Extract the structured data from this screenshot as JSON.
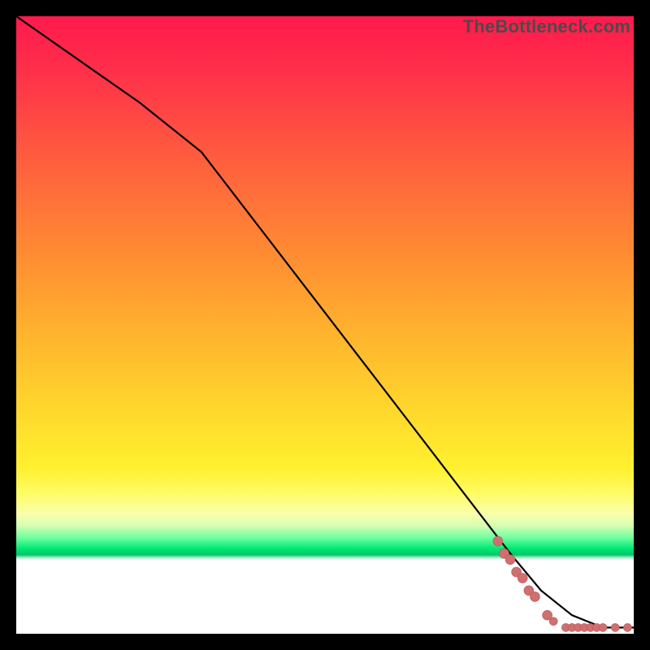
{
  "watermark": "TheBottleneck.com",
  "chart_data": {
    "type": "line",
    "title": "",
    "xlabel": "",
    "ylabel": "",
    "xlim": [
      0,
      100
    ],
    "ylim": [
      0,
      100
    ],
    "grid": false,
    "legend": false,
    "series": [
      {
        "name": "curve",
        "color": "#000000",
        "x": [
          0,
          10,
          20,
          30,
          40,
          50,
          60,
          70,
          80,
          85,
          90,
          95,
          100
        ],
        "y": [
          100,
          93,
          86,
          78,
          65,
          52,
          39,
          26,
          13,
          7,
          3,
          1,
          1
        ]
      }
    ],
    "scatter": {
      "name": "tail-points",
      "color": "#cf6f6f",
      "marker": "circle",
      "points": [
        {
          "x": 78,
          "y": 15
        },
        {
          "x": 79,
          "y": 13
        },
        {
          "x": 80,
          "y": 12
        },
        {
          "x": 81,
          "y": 10
        },
        {
          "x": 82,
          "y": 9
        },
        {
          "x": 83,
          "y": 7
        },
        {
          "x": 84,
          "y": 6
        },
        {
          "x": 86,
          "y": 3
        },
        {
          "x": 87,
          "y": 2
        },
        {
          "x": 89,
          "y": 1
        },
        {
          "x": 90,
          "y": 1
        },
        {
          "x": 91,
          "y": 1
        },
        {
          "x": 92,
          "y": 1
        },
        {
          "x": 93,
          "y": 1
        },
        {
          "x": 94,
          "y": 1
        },
        {
          "x": 95,
          "y": 1
        },
        {
          "x": 97,
          "y": 1
        },
        {
          "x": 99,
          "y": 1
        }
      ]
    },
    "gradient_background": {
      "top_color": "#ff1a4d",
      "mid_color": "#ffd82c",
      "green_band": "#00e874",
      "bottom_color": "#ffffff"
    }
  }
}
